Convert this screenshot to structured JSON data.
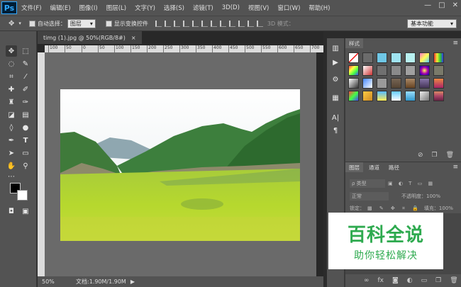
{
  "menubar": {
    "logo": "Ps",
    "items": [
      "文件(F)",
      "编辑(E)",
      "图像(I)",
      "图层(L)",
      "文字(Y)",
      "选择(S)",
      "滤镜(T)",
      "3D(D)",
      "视图(V)",
      "窗口(W)",
      "帮助(H)"
    ],
    "win_controls": [
      "—",
      "□",
      "✕"
    ]
  },
  "optionsbar": {
    "auto_select_label": "自动选择：",
    "auto_select_value": "图层",
    "show_transform_label": "显示变换控件",
    "mode3d_label": "3D 模式：",
    "workspace": "基本功能"
  },
  "document": {
    "tab_title": "timg (1).jpg @ 50%(RGB/8#)",
    "tab_close": "×",
    "ruler_ticks": [
      "100",
      "50",
      "0",
      "50",
      "100",
      "150",
      "200",
      "250",
      "300",
      "350",
      "400",
      "450",
      "500",
      "550",
      "600",
      "650",
      "700"
    ],
    "zoom": "50%",
    "doc_size": "文档:1.90M/1.90M"
  },
  "panels": {
    "styles_tab": "样式",
    "layers_tabs": [
      "图层",
      "通道",
      "路径"
    ],
    "kind_label": "ρ 类型",
    "blend_mode": "正常",
    "opacity_label": "不透明度：100%",
    "lock_label": "锁定：",
    "fill_label": "填充：100%"
  },
  "watermark": {
    "title": "百科全说",
    "subtitle": "助你轻松解决"
  },
  "colors": {
    "ui_bg": "#535353",
    "dark_bg": "#282828",
    "canvas_gray": "#6a6a6a",
    "watermark_green": "#2eaa4f"
  }
}
